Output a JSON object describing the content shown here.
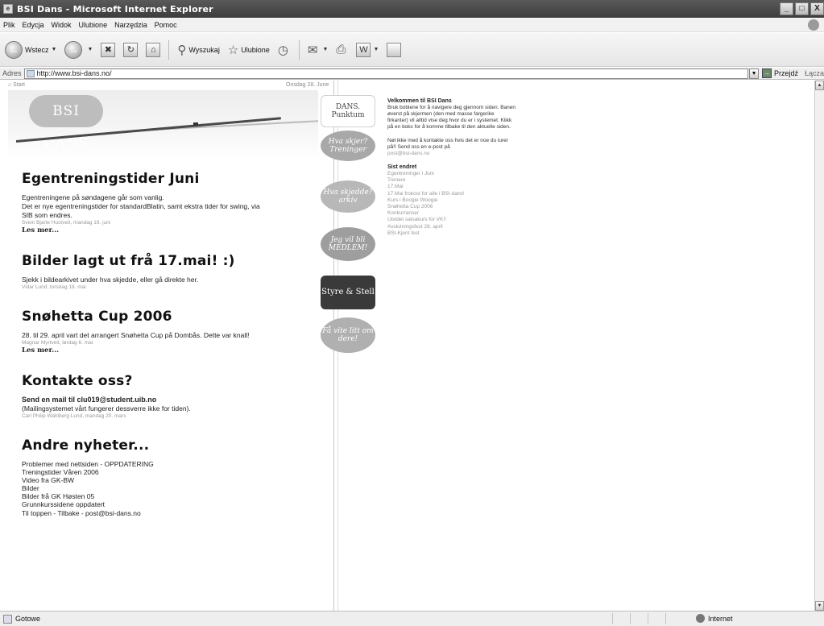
{
  "window": {
    "title": "BSI Dans - Microsoft Internet Explorer",
    "buttons": [
      "_",
      "□",
      "X"
    ]
  },
  "menu": [
    "Plik",
    "Edycja",
    "Widok",
    "Ulubione",
    "Narzędzia",
    "Pomoc"
  ],
  "toolbar": {
    "back_label": "Wstecz",
    "search_label": "Wyszukaj",
    "favorites_label": "Ulubione"
  },
  "address": {
    "label": "Adres",
    "url": "http://www.bsi-dans.no/",
    "go_label": "Przejdź",
    "links_label": "Łącza"
  },
  "site": {
    "crumbs": "⌂ Start",
    "date": "Onsdag 28. June",
    "logo_text": "BSI DANS",
    "articles": [
      {
        "title": "Egentreningstider Juni",
        "body": [
          "Egentreningene på søndagene går som vanlig.",
          "Det er nye egentreningstider for standardBlatin, samt ekstra tider for swing, via",
          "SIB som endres."
        ],
        "meta": "Svein Bjarte Hustveit, mandag 19. juni",
        "more": "Les mer..."
      },
      {
        "title": "Bilder lagt ut frå 17.mai! :)",
        "body": [
          "Sjekk i bildearkivet under hva skjedde, eller gå direkte her."
        ],
        "meta": "Vidar Lund, torsdag 18. mai",
        "more": ""
      },
      {
        "title": "Snøhetta Cup 2006",
        "body": [
          "28. til 29. april vart det arrangert Snøhetta Cup på Dombås. Dette var knall!"
        ],
        "meta": "Magnar Myrtveit, lørdag 6. mai",
        "more": "Les mer..."
      },
      {
        "title": "Kontakte oss?",
        "strong": "Send en mail til clu019@student.uib.no",
        "body": [
          "(Mailingsystemet vårt fungerer dessverre ikke for tiden)."
        ],
        "meta": "Carl Philip Wahlberg Lund, mandag 20. mars",
        "more": ""
      }
    ],
    "other": {
      "title": "Andre nyheter...",
      "items": [
        "Problemer med nettsiden - OPPDATERING",
        "Treningstider Våren 2006",
        "Video fra GK-BW",
        "Bilder",
        "Bilder frå GK Høsten 05",
        "Grunnkurssidene oppdatert"
      ],
      "footer": "Til toppen - Tilbake - post@bsi-dans.no"
    },
    "bubbles": {
      "punkt": "DANS. Punktum",
      "b1": "Hva skjer? Treninger",
      "b2": "Hva skjedde? arkiv",
      "b3": "Jeg vil bli MEDLEM!",
      "b4": "Styre & Stell",
      "b5": "Få vite litt om dere!"
    },
    "sidebar": {
      "welcome_title": "Velkommen til BSI Dans",
      "welcome_text": "Bruk boblene for å navigere deg gjennom siden. Banen øverst på skjermen (den med masse fargerike firkanter) vil alltid vise deg hvor du er i systemet. Klikk på en boks for å komme tilbake til den aktuelle siden.",
      "contact_text": "Nøl ikke med å kontakte oss hvis det er noe du lurer på!! Send oss en e-post på",
      "contact_email": "post@bsi-dans.no",
      "recent_title": "Sist endret",
      "recent_items": [
        "Egentreninger i Juni",
        "Trenere",
        "17.Mai",
        "17.Mai frokost for alle i BSI-dans!",
        "Kurs i Boogie Woogie",
        "Snøhetta Cup 2006",
        "Konkurranser",
        "Utvidet salsakurs for VK!!",
        "Avslutningsfest 28. april",
        "BSI-Kjent fest"
      ]
    }
  },
  "status": {
    "text": "Gotowe",
    "zone": "Internet"
  }
}
